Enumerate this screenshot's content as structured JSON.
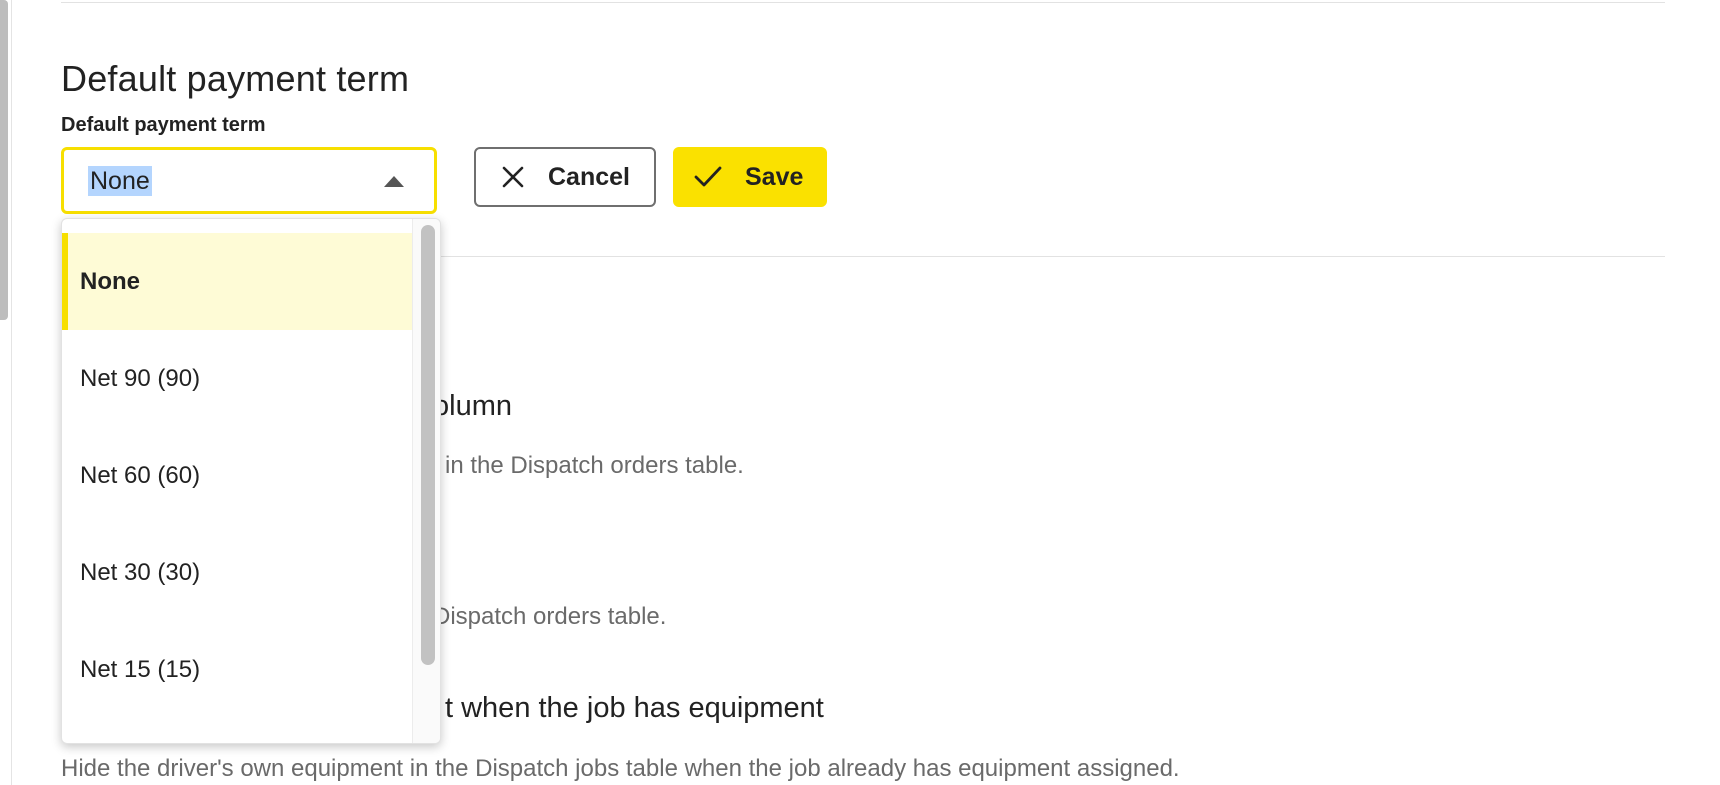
{
  "section": {
    "title": "Default payment term",
    "field_label": "Default payment term"
  },
  "select": {
    "value": "None",
    "options": [
      {
        "label": "None",
        "selected": true
      },
      {
        "label": "Net 90 (90)",
        "selected": false
      },
      {
        "label": "Net 60 (60)",
        "selected": false
      },
      {
        "label": "Net 30 (30)",
        "selected": false
      },
      {
        "label": "Net 15 (15)",
        "selected": false
      }
    ]
  },
  "actions": {
    "cancel_label": "Cancel",
    "save_label": "Save"
  },
  "background": {
    "column_heading_fragment": "olumn",
    "column_desc_fragment": "in the Dispatch orders table.",
    "second_desc_fragment": "Dispatch orders table.",
    "equipment_heading_fragment": "t when the job has equipment",
    "equipment_desc": "Hide the driver's own equipment in the Dispatch jobs table when the job already has equipment assigned."
  },
  "icons": {
    "cancel": "close-icon",
    "save": "check-icon",
    "select_caret": "caret-up-icon"
  },
  "colors": {
    "accent_yellow": "#fae100",
    "selected_option_bg": "#fefbd6",
    "text_highlight": "#b4d5fe"
  }
}
